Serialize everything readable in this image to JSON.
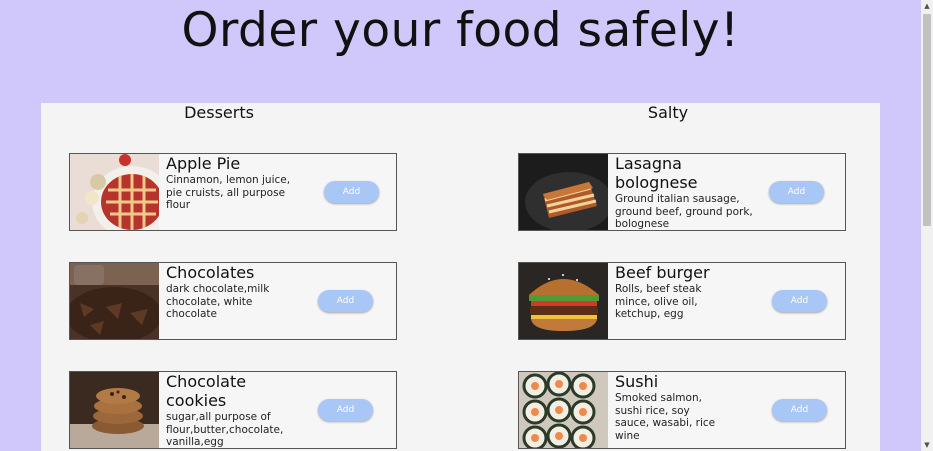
{
  "header": {
    "title": "Order your food safely!"
  },
  "columns": [
    {
      "heading": "Desserts",
      "items": [
        {
          "name": "Apple Pie",
          "description": "Cinnamon, lemon juice, pie cruists, all purpose flour",
          "button": "Add"
        },
        {
          "name": "Chocolates",
          "description": "dark chocolate,milk chocolate, white chocolate",
          "button": "Add"
        },
        {
          "name": "Chocolate cookies",
          "description": "sugar,all purpose of flour,butter,chocolate, vanilla,egg",
          "button": "Add"
        }
      ]
    },
    {
      "heading": "Salty",
      "items": [
        {
          "name": "Lasagna bolognese",
          "description": "Ground italian sausage, ground beef, ground pork, bolognese",
          "button": "Add"
        },
        {
          "name": "Beef burger",
          "description": "Rolls, beef steak mince, olive oil, ketchup, egg",
          "button": "Add"
        },
        {
          "name": "Sushi",
          "description": "Smoked salmon, sushi rice, soy sauce, wasabi, rice wine",
          "button": "Add"
        }
      ]
    }
  ],
  "colors": {
    "background": "#d0c7fb",
    "panel": "#f4f4f4",
    "button": "#a9c7f6"
  },
  "icons": {
    "scroll_up": "triangle-up",
    "scroll_down": "triangle-down"
  }
}
